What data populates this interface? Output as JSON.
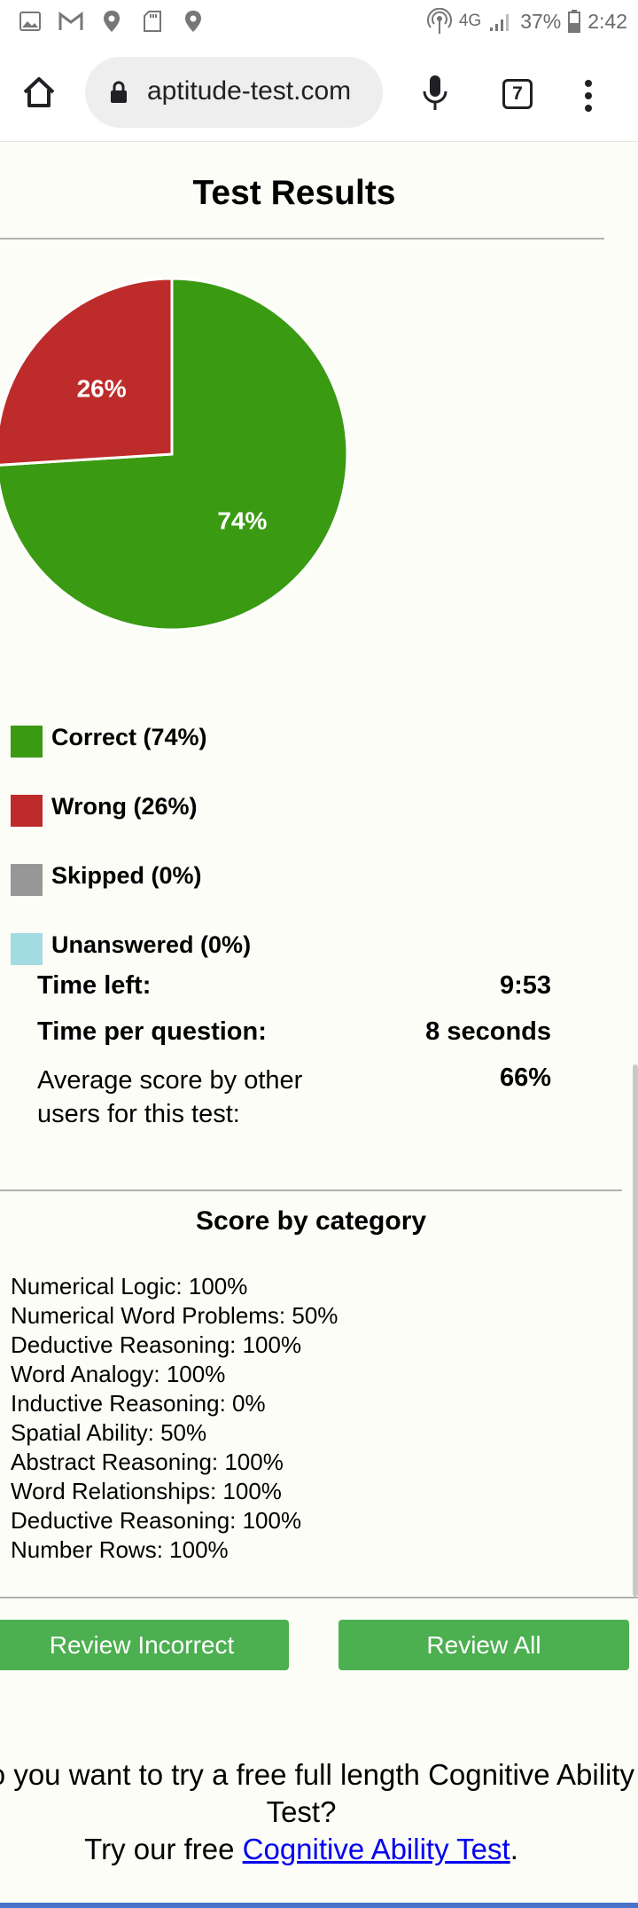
{
  "status_bar": {
    "network": "4G",
    "battery": "37%",
    "time": "2:42"
  },
  "browser": {
    "url": "aptitude-test.com",
    "tab_count": "7"
  },
  "page": {
    "title": "Test Results"
  },
  "chart_data": {
    "type": "pie",
    "slices": [
      {
        "label": "Correct",
        "value": 74,
        "color": "#3a9a12"
      },
      {
        "label": "Wrong",
        "value": 26,
        "color": "#bd2b2b"
      },
      {
        "label": "Skipped",
        "value": 0,
        "color": "#979797"
      },
      {
        "label": "Unanswered",
        "value": 0,
        "color": "#a3dbe3"
      }
    ],
    "data_labels": [
      "74%",
      "26%"
    ]
  },
  "legend": [
    {
      "label": "Correct (74%)",
      "color": "#3a9a12"
    },
    {
      "label": "Wrong (26%)",
      "color": "#bd2b2b"
    },
    {
      "label": "Skipped (0%)",
      "color": "#979797"
    },
    {
      "label": "Unanswered (0%)",
      "color": "#a3dbe3"
    }
  ],
  "stats": {
    "time_left_label": "Time left:",
    "time_left_value": "9:53",
    "time_per_question_label": "Time per question:",
    "time_per_question_value": "8 seconds",
    "average_label": "Average score by other users for this test:",
    "average_value": "66%"
  },
  "categories": {
    "title": "Score by category",
    "items": [
      "Numerical Logic: 100%",
      "Numerical Word Problems: 50%",
      "Deductive Reasoning: 100%",
      "Word Analogy: 100%",
      "Inductive Reasoning: 0%",
      "Spatial Ability: 50%",
      "Abstract Reasoning: 100%",
      "Word Relationships: 100%",
      "Deductive Reasoning: 100%",
      "Number Rows: 100%"
    ]
  },
  "buttons": {
    "review_incorrect": "Review Incorrect",
    "review_all": "Review All"
  },
  "promo": {
    "line1": "Do you want to try a free full length Cognitive Ability Test?",
    "line2_prefix": "Try our free ",
    "link_text": "Cognitive Ability Test",
    "line2_suffix": "."
  }
}
